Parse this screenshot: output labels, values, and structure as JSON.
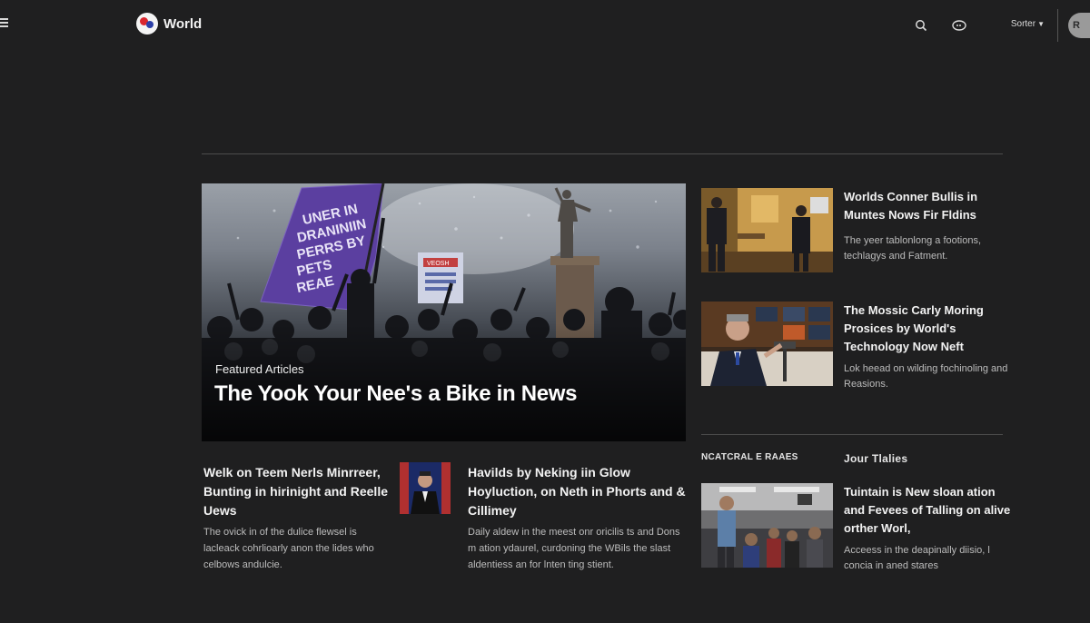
{
  "header": {
    "logo_text": "World",
    "section_selector": "Sorter",
    "avatar_initial": "R"
  },
  "hero": {
    "kicker": "Featured Articles",
    "title": "The Yook Your Nee's a Bike in News",
    "flag_text": "UNER IN DRANINIIN PERRS BY PETS REAE",
    "sign_text": "VEOSH"
  },
  "side_articles": [
    {
      "title": "Worlds Conner Bullis in Muntes Nows Fir Fldins",
      "desc": "The yeer tablonlong a footions, techlagys and Fatment."
    },
    {
      "title": "The Mossic Carly Moring Prosices by World's Technology Now Neft",
      "desc": "Lok heead on wilding fochinoling and Reasions."
    },
    {
      "title": "Tuintain is New sloan ation and Fevees of Talling on alive orther Worl,",
      "desc": "Acceess in the deapinally diisio, l concia in aned stares"
    }
  ],
  "section_labels": {
    "left": "NCATCRAL E RAAES",
    "right": "Jour Tlalies"
  },
  "bottom_articles": [
    {
      "title": "Welk on Teem Nerls Minrreer, Bunting in hirinight and Reelle Uews",
      "desc": "The ovick in of the dulice flewsel is lacleack cohrlioarly anon the lides who celbows andulcie."
    },
    {
      "title": "Havilds by Neking iin Glow Hoyluction, on Neth in Phorts and & Cillimey",
      "desc": "Daily aldew in the meest onr oricilis ts and Dons m ation ydaurel, curdoning the WBils the slast aldentiess an for lnten ting stient."
    }
  ],
  "colors": {
    "background": "#1f1f20",
    "flag": "#5b3fa0",
    "text": "#f2f2f2",
    "muted": "#bcbcbc"
  }
}
